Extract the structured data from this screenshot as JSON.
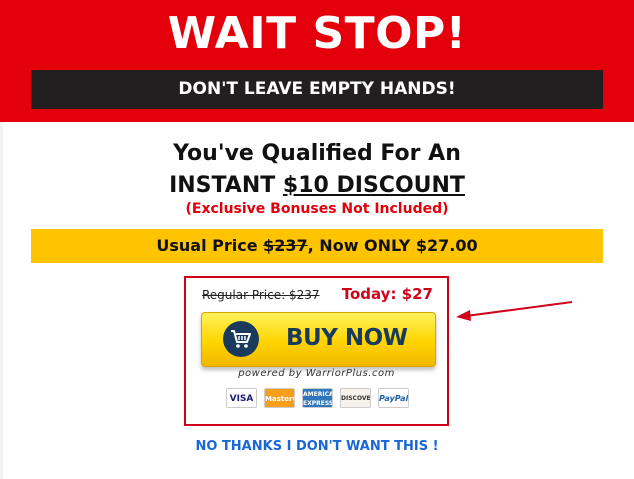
{
  "header": {
    "title": "WAIT STOP!",
    "subtitle": "DON'T LEAVE EMPTY HANDS!"
  },
  "offer": {
    "line1": "You've Qualified For An",
    "line2_prefix": "INSTANT ",
    "line2_amount": "$10 DISCOUNT",
    "note": "(Exclusive Bonuses Not Included)"
  },
  "price_bar": {
    "prefix": "Usual Price ",
    "old_price": "$237",
    "suffix": ", Now ONLY $27.00"
  },
  "buy_box": {
    "regular_price": "Regular Price: $237",
    "today_price": "Today: $27",
    "button_label": "BUY NOW",
    "powered_by": "powered by WarriorPlus.com",
    "cards": [
      "VISA",
      "MasterCard",
      "AMERICAN EXPRESS",
      "DISCOVER",
      "PayPal"
    ]
  },
  "decline_link": "NO THANKS I DON'T WANT THIS !",
  "colors": {
    "header_red": "#e3000b",
    "dark_bar": "#231f20",
    "price_bar_yellow": "#ffc400",
    "box_border": "#d0021b",
    "link_blue": "#1a66d6"
  },
  "icons": {
    "cart": "shopping-cart-icon",
    "arrow": "pointer-arrow-icon"
  }
}
